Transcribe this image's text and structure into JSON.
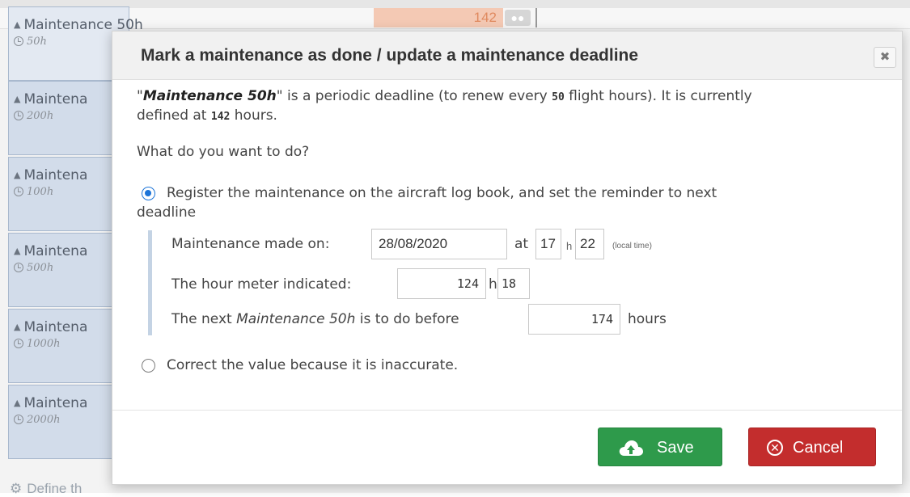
{
  "background": {
    "value_cell": "142",
    "side_items": [
      {
        "label": "Maintenance 50h",
        "sub": "50h"
      },
      {
        "label": "Maintena",
        "sub": "200h"
      },
      {
        "label": "Maintena",
        "sub": "100h"
      },
      {
        "label": "Maintena",
        "sub": "500h"
      },
      {
        "label": "Maintena",
        "sub": "1000h"
      },
      {
        "label": "Maintena",
        "sub": "2000h"
      }
    ],
    "bottom_text": "Define th"
  },
  "modal": {
    "title": "Mark a maintenance as done / update a maintenance deadline",
    "close_label": "✖",
    "intro": {
      "quote_open": "\"",
      "deadline_name": "Maintenance 50h",
      "quote_close": "\"",
      "part1": " is a periodic deadline (to renew every ",
      "period": "50",
      "part2": " flight hours). It is currently",
      "line2_prefix": "defined at ",
      "current": "142",
      "line2_suffix": " hours."
    },
    "question": "What do you want to do?",
    "option_register": {
      "line1": "Register the maintenance on the aircraft log book, and set the reminder to next",
      "line2": "deadline",
      "made_on_label": "Maintenance made on:",
      "date_value": "28/08/2020",
      "at_label": "at",
      "hour_value": "17",
      "h_sep": "h",
      "minute_value": "22",
      "local_time": "(local time)",
      "meter_label": "The hour meter indicated:",
      "meter_hours": "124",
      "meter_h": "h",
      "meter_minutes": "18",
      "next_prefix": "The next ",
      "next_name": "Maintenance 50h",
      "next_suffix": " is to do before",
      "next_value": "174",
      "next_unit": "hours"
    },
    "option_correct": "Correct the value because it is inaccurate.",
    "save_label": "Save",
    "cancel_label": "Cancel"
  },
  "colors": {
    "save": "#2e9a4b",
    "cancel": "#c32d2d",
    "radio": "#1c74d8"
  }
}
